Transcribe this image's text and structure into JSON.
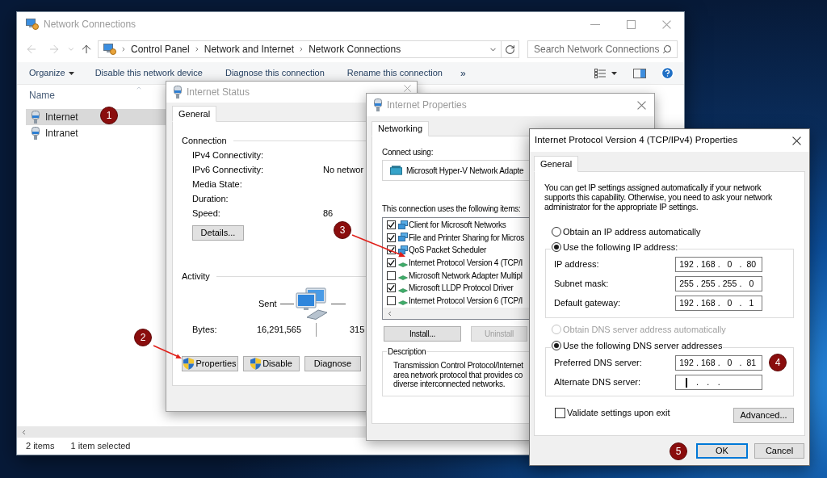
{
  "explorer": {
    "title": "Network Connections",
    "active": false,
    "breadcrumb": [
      "Control Panel",
      "Network and Internet",
      "Network Connections"
    ],
    "search": {
      "placeholder": "Search Network Connections"
    },
    "toolbar": {
      "menu": "Organize",
      "actions": [
        "Disable this network device",
        "Diagnose this connection",
        "Rename this connection"
      ],
      "overflow": "»"
    },
    "columns": [
      "Name"
    ],
    "items": [
      {
        "name": "Internet",
        "selected": true
      },
      {
        "name": "Intranet",
        "selected": false
      }
    ],
    "status_bar": [
      "2 items",
      "1 item selected"
    ]
  },
  "status_dialog": {
    "title": "Internet Status",
    "active": false,
    "tabs": [
      {
        "label": "General",
        "selected": true
      }
    ],
    "connection": {
      "heading": "Connection",
      "rows": [
        {
          "label": "IPv4 Connectivity:"
        },
        {
          "label": "IPv6 Connectivity:",
          "value": "No networ"
        },
        {
          "label": "Media State:"
        },
        {
          "label": "Duration:"
        },
        {
          "label": "Speed:",
          "value": "86"
        }
      ],
      "details_button": "Details..."
    },
    "activity": {
      "heading": "Activity",
      "sent_label": "Sent",
      "bytes_label": "Bytes:",
      "bytes_sent": "16,291,565",
      "bytes_received": "315"
    },
    "buttons": [
      {
        "label": "Properties",
        "shield": true
      },
      {
        "label": "Disable",
        "shield": true
      },
      {
        "label": "Diagnose",
        "shield": false
      }
    ]
  },
  "properties_dialog": {
    "title": "Internet Properties",
    "active": false,
    "tabs": [
      {
        "label": "Networking",
        "selected": true
      }
    ],
    "connect_using": {
      "label": "Connect using:",
      "adapter": "Microsoft Hyper-V Network Adapte"
    },
    "items_label": "This connection uses the following items:",
    "items": [
      {
        "kind": "service",
        "label": "Client for Microsoft Networks",
        "checked": true
      },
      {
        "kind": "service",
        "label": "File and Printer Sharing for Micros",
        "checked": true
      },
      {
        "kind": "service",
        "label": "QoS Packet Scheduler",
        "checked": true
      },
      {
        "kind": "protocol",
        "label": "Internet Protocol Version 4 (TCP/I",
        "checked": true
      },
      {
        "kind": "protocol",
        "label": "Microsoft Network Adapter Multipl",
        "checked": false
      },
      {
        "kind": "protocol",
        "label": "Microsoft LLDP Protocol Driver",
        "checked": true
      },
      {
        "kind": "protocol",
        "label": "Internet Protocol Version 6 (TCP/I",
        "checked": false
      }
    ],
    "buttons": [
      {
        "label": "Install...",
        "disabled": false
      },
      {
        "label": "Uninstall",
        "disabled": true
      }
    ],
    "description": {
      "heading": "Description",
      "lines": [
        "Transmission Control Protocol/Internet",
        "area network protocol that provides co",
        "diverse interconnected networks."
      ]
    }
  },
  "ipv4_dialog": {
    "title": "Internet Protocol Version 4 (TCP/IPv4) Properties",
    "active": true,
    "tabs": [
      {
        "label": "General",
        "selected": true
      }
    ],
    "intro": "You can get IP settings assigned automatically if your network supports this capability. Otherwise, you need to ask your network administrator for the appropriate IP settings.",
    "ip_options": [
      {
        "label": "Obtain an IP address automatically",
        "selected": false,
        "disabled": false
      },
      {
        "label": "Use the following IP address:",
        "selected": true,
        "disabled": false
      }
    ],
    "ip_fields": [
      {
        "label": "IP address:",
        "value": "192 . 168 . 0 . 80",
        "focused": false
      },
      {
        "label": "Subnet mask:",
        "value": "255 . 255 . 255 . 0",
        "focused": false
      },
      {
        "label": "Default gateway:",
        "value": "192 . 168 . 0 . 1",
        "focused": false
      }
    ],
    "dns_options": [
      {
        "label": "Obtain DNS server address automatically",
        "selected": false,
        "disabled": true
      },
      {
        "label": "Use the following DNS server addresses",
        "selected": true,
        "disabled": false
      }
    ],
    "dns_fields": [
      {
        "label": "Preferred DNS server:",
        "value": "192 . 168 . 0 . 81",
        "focused": false
      },
      {
        "label": "Alternate DNS server:",
        "value": " . . .",
        "focused": true
      }
    ],
    "validate": {
      "label": "Validate settings upon exit",
      "checked": false
    },
    "advanced_button": "Advanced...",
    "buttons": [
      {
        "label": "OK",
        "default": true
      },
      {
        "label": "Cancel",
        "default": false
      }
    ]
  },
  "callouts": [
    {
      "number": "1",
      "arrow": false
    },
    {
      "number": "2",
      "arrow": true
    },
    {
      "number": "3",
      "arrow": true
    },
    {
      "number": "4",
      "arrow": false
    },
    {
      "number": "5",
      "arrow": false
    }
  ]
}
